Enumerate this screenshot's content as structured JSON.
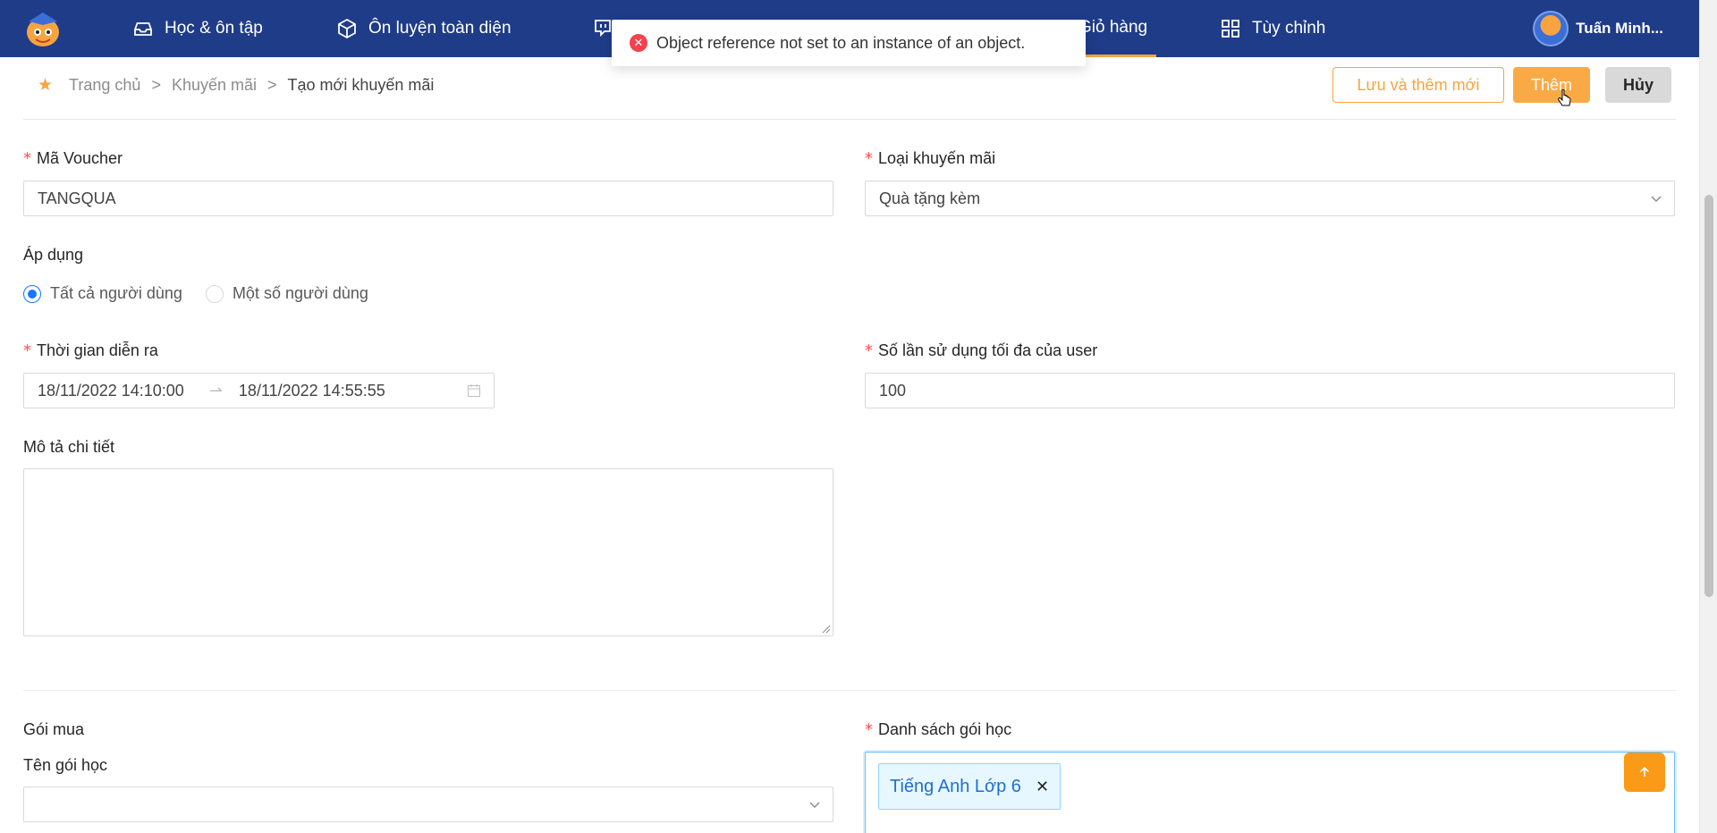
{
  "nav": {
    "items": [
      {
        "label": "Học & ôn tập",
        "icon": "inbox-icon"
      },
      {
        "label": "Ôn luyện toàn diện",
        "icon": "cube-icon"
      },
      {
        "label": "Giỏ hàng",
        "icon": "cart-icon",
        "active": true
      },
      {
        "label": "Tùy chỉnh",
        "icon": "grid-icon"
      }
    ],
    "user_name": "Tuấn Minh..."
  },
  "toast": {
    "message": "Object reference not set to an instance of an object."
  },
  "breadcrumb": {
    "items": [
      "Trang chủ",
      "Khuyến mãi",
      "Tạo mới khuyến mãi"
    ],
    "separator": ">"
  },
  "actions": {
    "save_new": "Lưu và thêm mới",
    "add": "Thêm",
    "cancel": "Hủy"
  },
  "form": {
    "voucher_label": "Mã Voucher",
    "voucher_value": "TANGQUA",
    "promo_type_label": "Loại khuyến mãi",
    "promo_type_value": "Quà tặng kèm",
    "apply_label": "Áp dụng",
    "apply_options": [
      "Tất cả người dùng",
      "Một số người dùng"
    ],
    "time_label": "Thời gian diễn ra",
    "time_start": "18/11/2022 14:10:00",
    "time_end": "18/11/2022 14:55:55",
    "max_use_label": "Số lần sử dụng tối đa của user",
    "max_use_value": "100",
    "desc_label": "Mô tả chi tiết",
    "package_section": "Gói mua",
    "package_name_label": "Tên gói học",
    "package_list_label": "Danh sách gói học",
    "package_tags": [
      "Tiếng Anh Lớp 6"
    ]
  },
  "colors": {
    "nav": "#1f3c88",
    "accent": "#f7a440",
    "danger": "#ff4d4f",
    "primary": "#1677ff"
  }
}
